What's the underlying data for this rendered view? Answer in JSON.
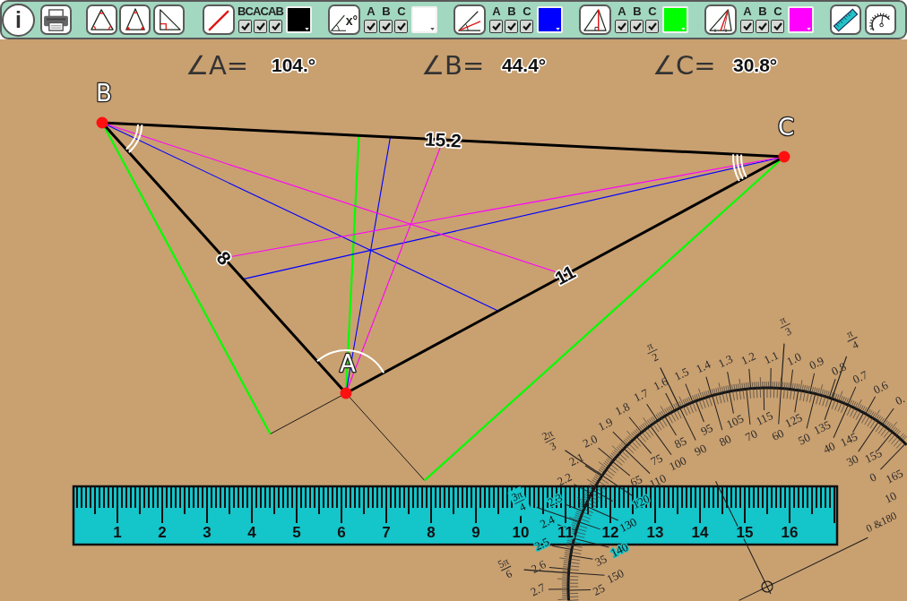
{
  "toolbar": {
    "info_button": {
      "label": "i"
    },
    "groups": [
      {
        "kind": "sides",
        "checkboxes": [
          {
            "label": "BC",
            "checked": true
          },
          {
            "label": "AC",
            "checked": true
          },
          {
            "label": "AB",
            "checked": true
          }
        ],
        "color": "#000000"
      },
      {
        "kind": "angles",
        "icon_label": "x°",
        "checkboxes": [
          {
            "label": "A",
            "checked": true
          },
          {
            "label": "B",
            "checked": true
          },
          {
            "label": "C",
            "checked": true
          }
        ],
        "color": "#ffffff"
      },
      {
        "kind": "bisectors",
        "checkboxes": [
          {
            "label": "A",
            "checked": true
          },
          {
            "label": "B",
            "checked": true
          },
          {
            "label": "C",
            "checked": true
          }
        ],
        "color": "#0000ff"
      },
      {
        "kind": "altitudes",
        "checkboxes": [
          {
            "label": "A",
            "checked": true
          },
          {
            "label": "B",
            "checked": true
          },
          {
            "label": "C",
            "checked": true
          }
        ],
        "color": "#00ff00"
      },
      {
        "kind": "medians",
        "checkboxes": [
          {
            "label": "A",
            "checked": true
          },
          {
            "label": "B",
            "checked": true
          },
          {
            "label": "C",
            "checked": true
          }
        ],
        "color": "#ff00ff"
      }
    ]
  },
  "angle_readouts": [
    {
      "label": "∠A=",
      "value": "104.°"
    },
    {
      "label": "∠B=",
      "value": "44.4°"
    },
    {
      "label": "∠C=",
      "value": "30.8°"
    }
  ],
  "vertices": [
    {
      "label": "A"
    },
    {
      "label": "B"
    },
    {
      "label": "C"
    }
  ],
  "side_labels": [
    "15.2",
    "11",
    "8"
  ],
  "ruler": {
    "labels": [
      "1",
      "2",
      "3",
      "4",
      "5",
      "6",
      "7",
      "8",
      "9",
      "10",
      "11",
      "12",
      "13",
      "14",
      "15",
      "16"
    ]
  },
  "protractor": {
    "fraction_labels": [
      {
        "numerator": "π",
        "denominator": "4"
      },
      {
        "numerator": "π",
        "denominator": "3"
      },
      {
        "numerator": "π",
        "denominator": "2"
      },
      {
        "numerator": "2π",
        "denominator": "3"
      },
      {
        "numerator": "3π",
        "denominator": "4"
      },
      {
        "numerator": "5π",
        "denominator": "6"
      }
    ],
    "radian_labels": [
      "0.",
      "0.6",
      "0.7",
      "0.8",
      "0.9",
      "1.0",
      "1.1",
      "1.2",
      "1.3",
      "1.4",
      "1.5",
      "1.6",
      "1.7",
      "1.8",
      "1.9",
      "2.0",
      "2.1",
      "2.2",
      "2.3",
      "2.4",
      "2.5",
      "2.6",
      "2.7"
    ],
    "outer_degree_labels": [
      "25",
      "35",
      "65",
      "75",
      "85",
      "95",
      "105",
      "115",
      "125",
      "135",
      "145",
      "155",
      "165"
    ],
    "inner_degree_labels": [
      "10",
      "0",
      "30",
      "40",
      "50",
      "60",
      "70",
      "80",
      "90",
      "100",
      "110",
      "120",
      "130",
      "140",
      "150"
    ],
    "baseline_label": "0 &180"
  }
}
